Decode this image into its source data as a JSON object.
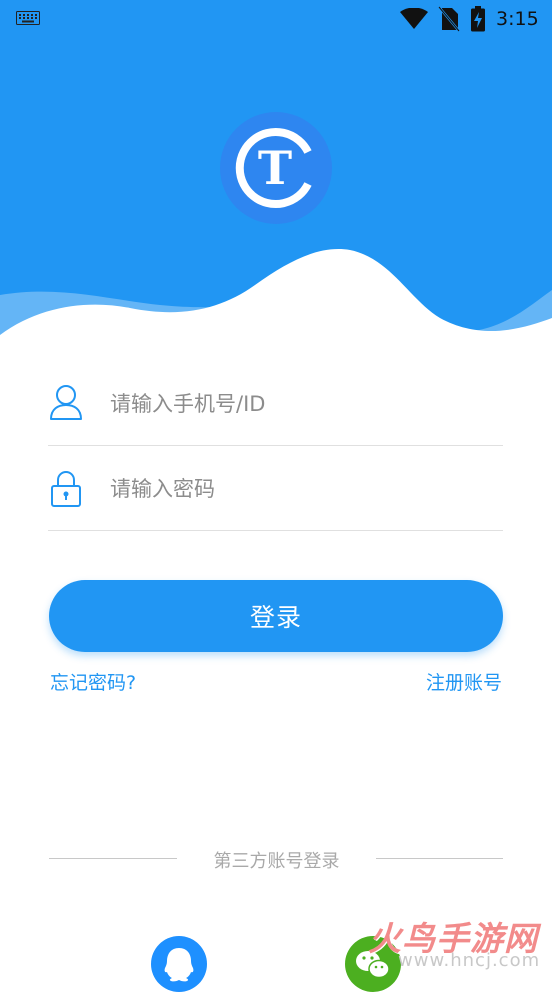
{
  "status_bar": {
    "time": "3:15",
    "icons": [
      "keyboard-icon",
      "wifi-icon",
      "no-sim-icon",
      "battery-charging-icon"
    ]
  },
  "logo": {
    "letter": "T"
  },
  "form": {
    "username_placeholder": "请输入手机号/ID",
    "password_placeholder": "请输入密码"
  },
  "login_button_label": "登录",
  "links": {
    "forgot_password": "忘记密码?",
    "register": "注册账号"
  },
  "third_party": {
    "label": "第三方账号登录",
    "providers": [
      "qq-icon",
      "wechat-icon"
    ]
  },
  "watermark": {
    "title": "火鸟手游网",
    "url": "www.hncj.com"
  },
  "colors": {
    "primary": "#2196f3",
    "wave_light": "#64b5f6",
    "logo_bg": "#2e86f0",
    "qq": "#1e90ff",
    "wechat": "#4caf20"
  }
}
